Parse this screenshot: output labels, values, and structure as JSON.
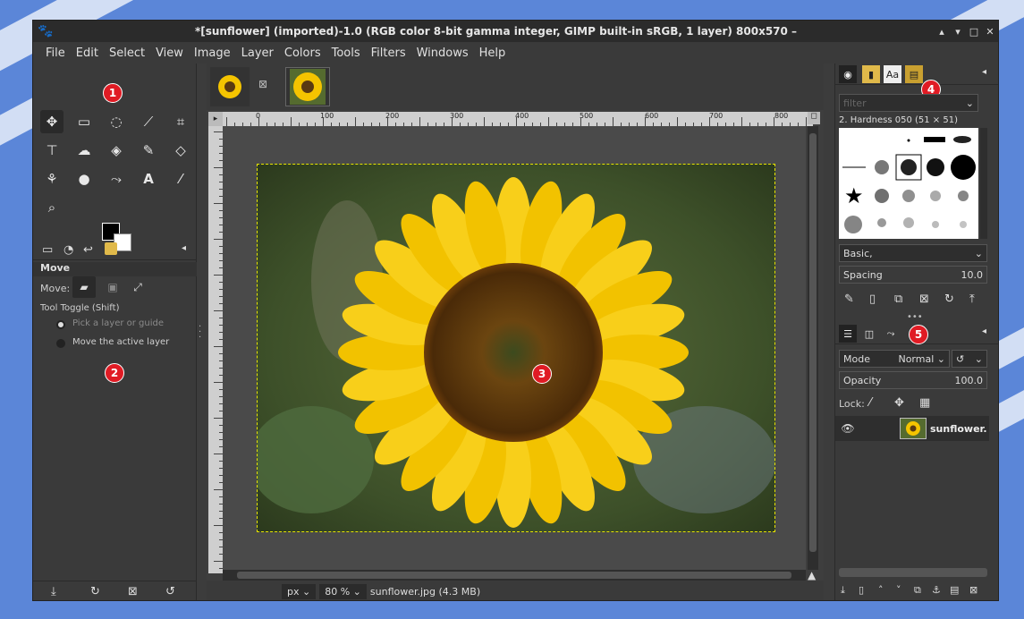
{
  "window": {
    "title": "*[sunflower] (imported)-1.0 (RGB color 8-bit gamma integer, GIMP built-in sRGB, 1 layer) 800x570 – ",
    "controls": [
      "▴",
      "▾",
      "□",
      "✕"
    ]
  },
  "menubar": [
    "File",
    "Edit",
    "Select",
    "View",
    "Image",
    "Layer",
    "Colors",
    "Tools",
    "Filters",
    "Windows",
    "Help"
  ],
  "annotations": [
    "1",
    "2",
    "3",
    "4",
    "5"
  ],
  "tool_options": {
    "title": "Move",
    "move_label": "Move:",
    "toggle_label": "Tool Toggle  (Shift)",
    "option1": "Pick a layer or guide",
    "option2": "Move the active layer"
  },
  "ruler_labels": [
    "0",
    "100",
    "200",
    "300",
    "400",
    "500",
    "600",
    "700",
    "800"
  ],
  "status": {
    "unit": "px",
    "zoom": "80 %",
    "file": "sunflower.jpg (4.3 MB)"
  },
  "brushes": {
    "filter_placeholder": "filter",
    "brush_name": "2. Hardness 050 (51 × 51)",
    "preset": "Basic,",
    "spacing_label": "Spacing",
    "spacing_value": "10.0"
  },
  "layers": {
    "mode_label": "Mode",
    "mode_value": "Normal",
    "opacity_label": "Opacity",
    "opacity_value": "100.0",
    "lock_label": "Lock:",
    "layer_name": "sunflower."
  },
  "colors": {
    "accent_badge": "#e01b24",
    "selection": "#e8e500"
  }
}
